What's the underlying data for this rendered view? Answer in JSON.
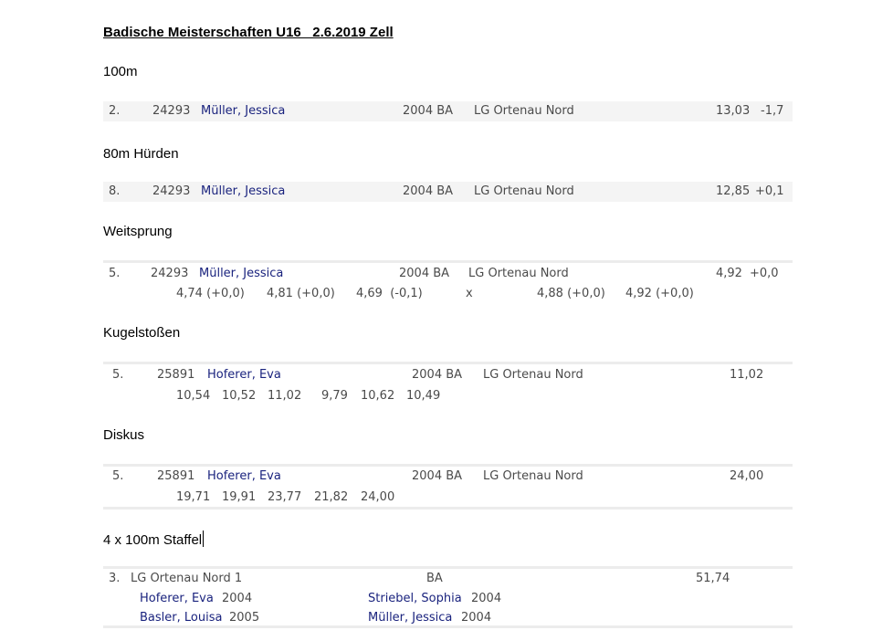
{
  "title": "Badische Meisterschaften U16   2.6.2019 Zell",
  "events": [
    {
      "name": "100m",
      "result": {
        "place": "2.",
        "id": "24293",
        "athlete": "Müller, Jessica",
        "year_region": "2004 BA",
        "club": "LG Ortenau Nord",
        "performance": "13,03",
        "wind": "-1,7"
      }
    },
    {
      "name": "80m Hürden",
      "result": {
        "place": "8.",
        "id": "24293",
        "athlete": "Müller, Jessica",
        "year_region": "2004 BA",
        "club": "LG Ortenau Nord",
        "performance": "12,85",
        "wind": "+0,1"
      }
    },
    {
      "name": "Weitsprung",
      "result": {
        "place": "5.",
        "id": "24293",
        "athlete": "Müller, Jessica",
        "year_region": "2004 BA",
        "club": "LG Ortenau Nord",
        "performance": "4,92",
        "wind": "+0,0"
      },
      "attempts": [
        "4,74 (+0,0)",
        "4,81 (+0,0)",
        "4,69  (-0,1)",
        "x",
        "4,88 (+0,0)",
        "4,92 (+0,0)"
      ]
    },
    {
      "name": "Kugelstoßen",
      "result": {
        "place": "5.",
        "id": "25891",
        "athlete": "Hoferer, Eva",
        "year_region": "2004 BA",
        "club": "LG Ortenau Nord",
        "performance": "11,02"
      },
      "attempts": [
        "10,54",
        "10,52",
        "11,02",
        "9,79",
        "10,62",
        "10,49"
      ]
    },
    {
      "name": "Diskus",
      "result": {
        "place": "5.",
        "id": "25891",
        "athlete": "Hoferer, Eva",
        "year_region": "2004 BA",
        "club": "LG Ortenau Nord",
        "performance": "24,00"
      },
      "attempts": [
        "19,71",
        "19,91",
        "23,77",
        "21,82",
        "24,00"
      ]
    },
    {
      "name": "4 x 100m Staffel",
      "result": {
        "place": "3.",
        "team": "LG Ortenau Nord 1",
        "region": "BA",
        "performance": "51,74"
      },
      "runners": [
        {
          "name": "Hoferer, Eva",
          "year": "2004"
        },
        {
          "name": "Striebel, Sophia",
          "year": "2004"
        },
        {
          "name": "Basler, Louisa",
          "year": "2005"
        },
        {
          "name": "Müller, Jessica",
          "year": "2004"
        }
      ]
    }
  ]
}
